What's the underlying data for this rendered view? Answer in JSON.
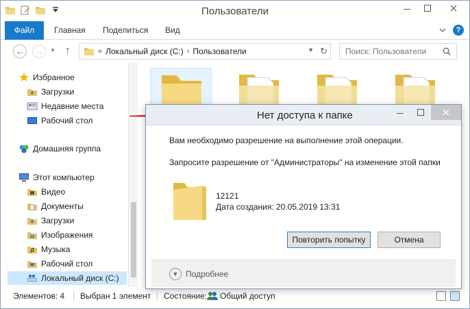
{
  "window": {
    "title": "Пользователи"
  },
  "ribbon": {
    "tabs": [
      "Файл",
      "Главная",
      "Поделиться",
      "Вид"
    ]
  },
  "address": {
    "overflow": "«",
    "crumbs": [
      "Локальный диск (C:)",
      "Пользователи"
    ],
    "search_placeholder": "Поиск: Пользователи"
  },
  "nav": {
    "items": [
      {
        "label": "Избранное",
        "icon": "star-icon"
      },
      {
        "label": "Загрузки",
        "icon": "downloads-folder-icon"
      },
      {
        "label": "Недавние места",
        "icon": "recent-places-icon"
      },
      {
        "label": "Рабочий стол",
        "icon": "desktop-icon"
      },
      {
        "label": "Домашняя группа",
        "icon": "homegroup-icon"
      },
      {
        "label": "Этот компьютер",
        "icon": "computer-icon"
      },
      {
        "label": "Видео",
        "icon": "video-folder-icon"
      },
      {
        "label": "Документы",
        "icon": "documents-folder-icon"
      },
      {
        "label": "Загрузки",
        "icon": "downloads-folder-icon"
      },
      {
        "label": "Изображения",
        "icon": "pictures-folder-icon"
      },
      {
        "label": "Музыка",
        "icon": "music-folder-icon"
      },
      {
        "label": "Рабочий стол",
        "icon": "desktop-folder-icon"
      },
      {
        "label": "Локальный диск (C:)",
        "icon": "drive-icon"
      }
    ]
  },
  "status": {
    "count": "Элементов: 4",
    "selected": "Выбран 1 элемент",
    "state_label": "Состояние:",
    "state_value": "Общий доступ"
  },
  "dialog": {
    "title": "Нет доступа к папке",
    "message1": "Вам необходимо разрешение на выполнение этой операции.",
    "message2": "Запросите разрешение от \"Администраторы\" на изменение этой папки",
    "folder_name": "12121",
    "created": "Дата создания: 20.05.2019 13:31",
    "retry_label": "Повторить попытку",
    "cancel_label": "Отмена",
    "more_label": "Подробнее"
  },
  "colors": {
    "accent": "#1979ca",
    "selection": "#cce8ff",
    "folder": "#f2d57a",
    "arrow": "#e02020"
  }
}
